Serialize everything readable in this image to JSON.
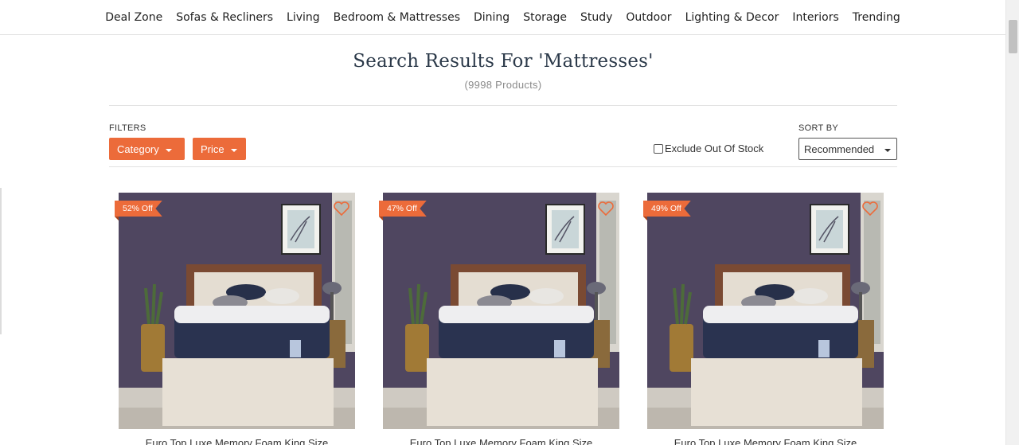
{
  "nav": {
    "items": [
      "Deal Zone",
      "Sofas & Recliners",
      "Living",
      "Bedroom & Mattresses",
      "Dining",
      "Storage",
      "Study",
      "Outdoor",
      "Lighting & Decor",
      "Interiors",
      "Trending"
    ]
  },
  "search": {
    "title": "Search Results For 'Mattresses'",
    "count": "(9998 Products)"
  },
  "filters": {
    "label": "FILTERS",
    "category": "Category",
    "price": "Price"
  },
  "exclude": {
    "label": "Exclude Out Of Stock",
    "checked": false
  },
  "sort": {
    "label": "SORT BY",
    "value": "Recommended"
  },
  "products": [
    {
      "badge": "52% Off",
      "title": "Euro Top Luxe Memory Foam King Size"
    },
    {
      "badge": "47% Off",
      "title": "Euro Top Luxe Memory Foam King Size"
    },
    {
      "badge": "49% Off",
      "title": "Euro Top Luxe Memory Foam King Size"
    }
  ],
  "colors": {
    "accent": "#ec6b3a",
    "heading": "#2c3a4a",
    "wall": "#4f4660",
    "mattress": "#2a3350"
  },
  "icons": {
    "wishlist": "heart-outline-icon",
    "dropdown": "caret-down-icon"
  }
}
